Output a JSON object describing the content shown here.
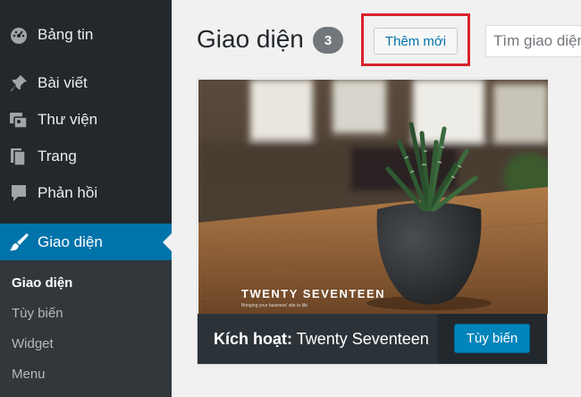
{
  "sidebar": {
    "items": [
      {
        "label": "Bảng tin",
        "icon": "dashboard-icon"
      },
      {
        "label": "Bài viết",
        "icon": "pin-icon"
      },
      {
        "label": "Thư viện",
        "icon": "media-icon"
      },
      {
        "label": "Trang",
        "icon": "page-icon"
      },
      {
        "label": "Phản hồi",
        "icon": "comment-icon"
      },
      {
        "label": "Giao diện",
        "icon": "paintbrush-icon",
        "active": true
      }
    ],
    "submenu": [
      "Giao diện",
      "Tùy biến",
      "Widget",
      "Menu"
    ],
    "colors": {
      "bg": "#23282d",
      "active": "#0073aa",
      "submenu_bg": "#32373c"
    }
  },
  "header": {
    "title": "Giao diện",
    "count": "3",
    "add_new_label": "Thêm mới",
    "search_placeholder": "Tìm giao diện..."
  },
  "theme": {
    "screenshot_title": "TWENTY SEVENTEEN",
    "screenshot_tagline": "Bringing your business' site to life",
    "active_prefix": "Kích hoạt:",
    "name": "Twenty Seventeen",
    "customize_label": "Tùy biến"
  },
  "highlight_color": "#d9232a"
}
